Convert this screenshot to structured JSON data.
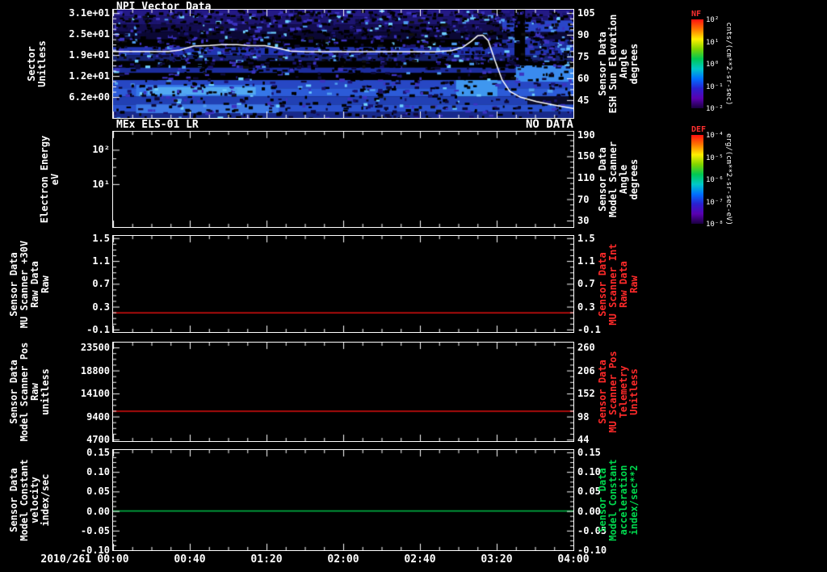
{
  "page": {
    "date_label": "2010/261",
    "time_ticks": [
      "00:00",
      "00:40",
      "01:20",
      "02:00",
      "02:40",
      "03:20",
      "04:00"
    ],
    "background": "#000000"
  },
  "colorbars": [
    {
      "name": "NF",
      "name_color": "#ff3030",
      "units": "cnts/(cm**2-sr-sec)",
      "ticks": [
        "10²",
        "10¹",
        "10⁰",
        "10⁻¹",
        "10⁻²"
      ],
      "stops": [
        "#ff1010",
        "#ff7700",
        "#ffee00",
        "#7fd400",
        "#00c853",
        "#00c8c8",
        "#0070ff",
        "#2a1fd0",
        "#5a00b0",
        "#1a0040"
      ]
    },
    {
      "name": "DEF",
      "name_color": "#ff3030",
      "units": "erg/(cm**2-sr-sec-eV)",
      "ticks": [
        "10⁻⁴",
        "10⁻⁵",
        "10⁻⁶",
        "10⁻⁷",
        "10⁻⁸"
      ],
      "stops": [
        "#ff1010",
        "#ff7700",
        "#ffee00",
        "#7fd400",
        "#00c853",
        "#00c8c8",
        "#0070ff",
        "#2a1fd0",
        "#5a00b0",
        "#1a0040"
      ]
    }
  ],
  "chart_data": [
    {
      "type": "heatmap",
      "title": "NPI Vector Data",
      "left_axis": {
        "label": "Sector\nUnitless",
        "color": "#ffffff",
        "min": 0,
        "max": 32,
        "ticks": [
          {
            "label": "3.1e+01",
            "value": 31
          },
          {
            "label": "2.5e+01",
            "value": 24.8
          },
          {
            "label": "1.9e+01",
            "value": 18.6
          },
          {
            "label": "1.2e+01",
            "value": 12.4
          },
          {
            "label": "6.2e+00",
            "value": 6.2
          }
        ]
      },
      "right_axis": {
        "label": "Sensor Data\nESH Sun Elevation\nAngle\ndegrees",
        "color": "#ffffff",
        "min": 32.7,
        "max": 107.3,
        "ticks": [
          {
            "label": "105",
            "value": 105
          },
          {
            "label": "90",
            "value": 90
          },
          {
            "label": "75",
            "value": 75
          },
          {
            "label": "60",
            "value": 60
          },
          {
            "label": "45",
            "value": 45
          }
        ]
      },
      "heatmap": {
        "noise_seed": 7,
        "noise_count": 2200,
        "bands": [
          {
            "y0": 0.0,
            "y1": 0.065,
            "color": "#241a85"
          },
          {
            "y0": 0.065,
            "y1": 0.135,
            "color": "#1d1570"
          },
          {
            "y0": 0.135,
            "y1": 0.205,
            "color": "#130d50"
          },
          {
            "y0": 0.205,
            "y1": 0.275,
            "color": "#0b0834"
          },
          {
            "y0": 0.275,
            "y1": 0.345,
            "color": "#000000"
          },
          {
            "y0": 0.345,
            "y1": 0.42,
            "color": "#2135b2"
          },
          {
            "y0": 0.42,
            "y1": 0.475,
            "color": "#162272"
          },
          {
            "y0": 0.475,
            "y1": 0.535,
            "color": "#000000"
          },
          {
            "y0": 0.535,
            "y1": 0.585,
            "color": "#1c2d9d"
          },
          {
            "y0": 0.585,
            "y1": 0.65,
            "color": "#000000"
          },
          {
            "y0": 0.65,
            "y1": 0.725,
            "color": "#2747c4"
          },
          {
            "y0": 0.725,
            "y1": 0.8,
            "color": "#2c5bd8"
          },
          {
            "y0": 0.8,
            "y1": 0.875,
            "color": "#2140b4"
          },
          {
            "y0": 0.875,
            "y1": 0.945,
            "color": "#2a52cf"
          },
          {
            "y0": 0.945,
            "y1": 1.0,
            "color": "#18298b"
          }
        ],
        "patches": [
          {
            "x0": 0.05,
            "x1": 0.345,
            "y0": 0.695,
            "y1": 0.8,
            "color": "#3577e8"
          },
          {
            "x0": 0.075,
            "x1": 0.31,
            "y0": 0.715,
            "y1": 0.785,
            "color": "#52a9f2"
          },
          {
            "x0": 0.05,
            "x1": 0.36,
            "y0": 0.875,
            "y1": 0.955,
            "color": "#3d7ae6"
          },
          {
            "x0": 0.745,
            "x1": 0.835,
            "y0": 0.65,
            "y1": 0.8,
            "color": "#3f97ef"
          },
          {
            "x0": 0.875,
            "x1": 1.0,
            "y0": 0.515,
            "y1": 0.665,
            "color": "#3a8bee"
          },
          {
            "x0": 0.845,
            "x1": 1.0,
            "y0": 0.1,
            "y1": 0.205,
            "color": "#2a46c8"
          },
          {
            "x0": 0.845,
            "x1": 1.0,
            "y0": 0.275,
            "y1": 0.345,
            "color": "#1c2d9d"
          },
          {
            "x0": 0.872,
            "x1": 0.895,
            "y0": 0.0,
            "y1": 0.515,
            "color": "#000000"
          },
          {
            "x0": 0.9,
            "x1": 1.0,
            "y0": 0.8,
            "y1": 0.875,
            "color": "#0a0a28"
          }
        ]
      },
      "overlay_line": {
        "color": "#ffffff",
        "axis": "right",
        "points": [
          [
            0.0,
            78.5
          ],
          [
            0.12,
            78.5
          ],
          [
            0.145,
            79.5
          ],
          [
            0.175,
            82.3
          ],
          [
            0.21,
            82.6
          ],
          [
            0.235,
            83.2
          ],
          [
            0.27,
            83.2
          ],
          [
            0.295,
            82.5
          ],
          [
            0.33,
            82.5
          ],
          [
            0.355,
            81.0
          ],
          [
            0.385,
            78.8
          ],
          [
            0.42,
            78.3
          ],
          [
            0.7,
            78.3
          ],
          [
            0.735,
            79.0
          ],
          [
            0.76,
            81.5
          ],
          [
            0.778,
            85.5
          ],
          [
            0.792,
            89.3
          ],
          [
            0.803,
            89.8
          ],
          [
            0.815,
            86.0
          ],
          [
            0.83,
            72.0
          ],
          [
            0.845,
            59.0
          ],
          [
            0.862,
            51.0
          ],
          [
            0.885,
            47.0
          ],
          [
            0.92,
            44.0
          ],
          [
            0.96,
            41.5
          ],
          [
            1.0,
            39.2
          ]
        ]
      }
    },
    {
      "type": "empty",
      "title": "MEx ELS-01 LR",
      "note": "NO DATA",
      "left_axis": {
        "label": "Electron Energy\neV",
        "color": "#ffffff",
        "log": true,
        "ticks": [
          {
            "label": "10²",
            "pos": 0.19
          },
          {
            "label": "10¹",
            "pos": 0.55
          }
        ]
      },
      "right_axis": {
        "label": "Sensor Data\nModel Scanner\nAngle\ndegrees",
        "color": "#ffffff",
        "min": 18,
        "max": 196,
        "ticks": [
          {
            "label": "190",
            "value": 190
          },
          {
            "label": "150",
            "value": 150
          },
          {
            "label": "110",
            "value": 110
          },
          {
            "label": "70",
            "value": 70
          },
          {
            "label": "30",
            "value": 30
          }
        ]
      }
    },
    {
      "type": "line",
      "left_axis": {
        "label": "Sensor Data\nMU Scanner +30V\nRaw Data\nRaw",
        "color": "#ffffff",
        "min": -0.145,
        "max": 1.54,
        "ticks": [
          {
            "label": "1.5",
            "value": 1.5
          },
          {
            "label": "1.1",
            "value": 1.1
          },
          {
            "label": "0.7",
            "value": 0.7
          },
          {
            "label": "0.3",
            "value": 0.3
          },
          {
            "label": "-0.1",
            "value": -0.1
          }
        ]
      },
      "right_axis": {
        "label": "Sensor Data\nMU Scanner Int\nRaw Data\nRaw",
        "color": "#ff2a2a",
        "min": -0.145,
        "max": 1.54,
        "ticks": [
          {
            "label": "1.5",
            "value": 1.5
          },
          {
            "label": "1.1",
            "value": 1.1
          },
          {
            "label": "0.7",
            "value": 0.7
          },
          {
            "label": "0.3",
            "value": 0.3
          },
          {
            "label": "-0.1",
            "value": -0.1
          }
        ]
      },
      "line": {
        "color": "#e01010",
        "value": 0.19
      }
    },
    {
      "type": "line",
      "left_axis": {
        "label": "Sensor Data\nModel Scanner Pos\nRaw\nunitless",
        "color": "#ffffff",
        "min": 4380,
        "max": 24500,
        "ticks": [
          {
            "label": "23500",
            "value": 23500
          },
          {
            "label": "18800",
            "value": 18800
          },
          {
            "label": "14100",
            "value": 14100
          },
          {
            "label": "9400",
            "value": 9400
          },
          {
            "label": "4700",
            "value": 4700
          }
        ]
      },
      "right_axis": {
        "label": "Sensor Data\nMU Scanner Pos\nTelemetry\nUnitless",
        "color": "#ff2a2a",
        "min": 40.4,
        "max": 271.5,
        "ticks": [
          {
            "label": "260",
            "value": 260
          },
          {
            "label": "206",
            "value": 206
          },
          {
            "label": "152",
            "value": 152
          },
          {
            "label": "98",
            "value": 98
          },
          {
            "label": "44",
            "value": 44
          }
        ]
      },
      "line": {
        "color": "#e01010",
        "value": 10500
      }
    },
    {
      "type": "line",
      "left_axis": {
        "label": "Sensor Data\nModel Constant\nvelocity\nindex/sec",
        "color": "#ffffff",
        "min": -0.1,
        "max": 0.156,
        "ticks": [
          {
            "label": "0.15",
            "value": 0.15
          },
          {
            "label": "0.10",
            "value": 0.1
          },
          {
            "label": "0.05",
            "value": 0.05
          },
          {
            "label": "0.00",
            "value": 0.0
          },
          {
            "label": "-0.05",
            "value": -0.05
          },
          {
            "label": "-0.10",
            "value": -0.1
          }
        ]
      },
      "right_axis": {
        "label": "Sensor Data\nModel Constant\nacceleration\nindex/sec**2",
        "color": "#00d84e",
        "min": -0.1,
        "max": 0.156,
        "ticks": [
          {
            "label": "0.15",
            "value": 0.15
          },
          {
            "label": "0.10",
            "value": 0.1
          },
          {
            "label": "0.05",
            "value": 0.05
          },
          {
            "label": "0.00",
            "value": 0.0
          },
          {
            "label": "-0.05",
            "value": -0.05
          },
          {
            "label": "-0.10",
            "value": -0.1
          }
        ]
      },
      "line": {
        "color": "#00c24a",
        "value": 0.0
      }
    }
  ]
}
